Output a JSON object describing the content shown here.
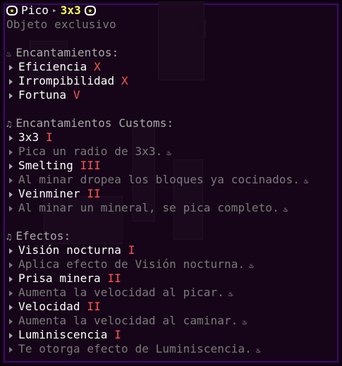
{
  "header": {
    "name": "Pico",
    "variant": "3x3",
    "subtitle": "Objeto exclusivo"
  },
  "sections": [
    {
      "title": "Encantamientos:",
      "icon": "fire-icon",
      "items": [
        {
          "name": "Eficiencia",
          "level": "X"
        },
        {
          "name": "Irrompibilidad",
          "level": "X"
        },
        {
          "name": "Fortuna",
          "level": "V"
        }
      ]
    },
    {
      "title": "Encantamientos Customs:",
      "icon": "music-note-icon",
      "items": [
        {
          "name": "3x3",
          "level": "I",
          "desc": "Pica un radio de 3x3."
        },
        {
          "name": "Smelting",
          "level": "III",
          "desc": "Al minar dropea los bloques ya cocinados."
        },
        {
          "name": "Veinminer",
          "level": "II",
          "desc": "Al minar un mineral, se pica completo."
        }
      ]
    },
    {
      "title": "Efectos:",
      "icon": "music-note-icon",
      "items": [
        {
          "name": "Visión nocturna",
          "level": "I",
          "desc": "Aplica efecto de Visión nocturna."
        },
        {
          "name": "Prisa minera",
          "level": "II",
          "desc": "Aumenta la velocidad al picar."
        },
        {
          "name": "Velocidad",
          "level": "II",
          "desc": "Aumenta la velocidad al caminar."
        },
        {
          "name": "Luminiscencia",
          "level": "I",
          "desc": "Te otorga efecto de Luminiscencia."
        }
      ]
    }
  ],
  "colors": {
    "background": "#160418",
    "border": "#3a0a6e",
    "title_accent": "#ffff55",
    "level": "#ff5555"
  }
}
